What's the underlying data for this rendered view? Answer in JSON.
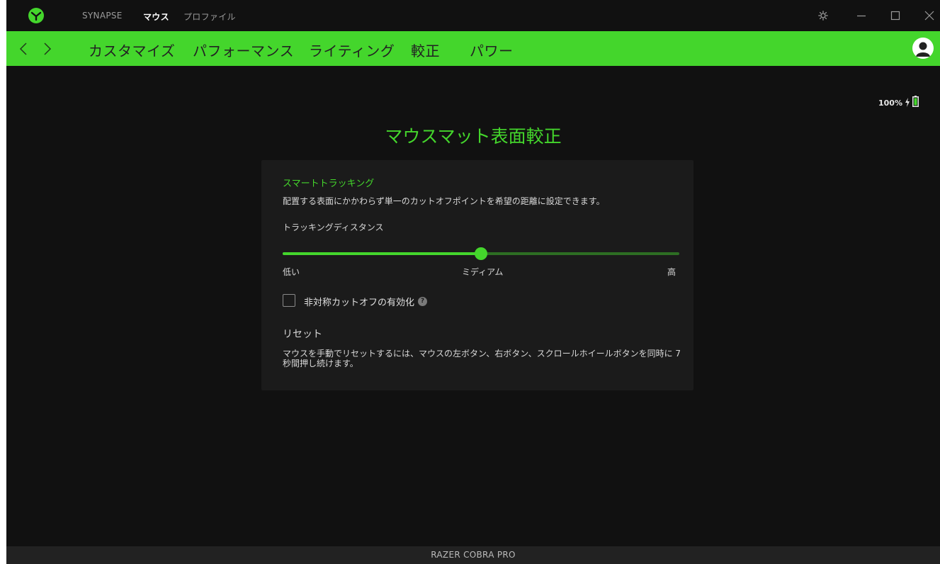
{
  "titlebar": {
    "tabs": [
      {
        "label": "SYNAPSE",
        "active": false
      },
      {
        "label": "マウス",
        "active": true
      },
      {
        "label": "プロファイル",
        "active": false
      }
    ]
  },
  "nav": {
    "tabs": [
      {
        "label": "カスタマイズ"
      },
      {
        "label": "パフォーマンス"
      },
      {
        "label": "ライティング"
      },
      {
        "label": "較正"
      },
      {
        "label": "パワー"
      }
    ]
  },
  "battery": {
    "level": "100%",
    "charging": true
  },
  "page": {
    "title": "マウスマット表面較正"
  },
  "smart_tracking": {
    "heading": "スマートトラッキング",
    "description": "配置する表面にかかわらず単一のカットオフポイントを希望の距離に設定できます。",
    "slider": {
      "label": "トラッキングディスタンス",
      "value_fraction": 0.5,
      "min_label": "低い",
      "mid_label": "ミディアム",
      "max_label": "高"
    },
    "asymmetric": {
      "label": "非対称カットオフの有効化",
      "checked": false
    }
  },
  "reset": {
    "heading": "リセット",
    "description": "マウスを手動でリセットするには、マウスの左ボタン、右ボタン、スクロールホイールボタンを同時に 7 秒間押し続けます。"
  },
  "footer": {
    "device_name": "RAZER COBRA PRO"
  },
  "colors": {
    "accent": "#44d62c",
    "background": "#111111",
    "card": "#1b1b1b"
  }
}
